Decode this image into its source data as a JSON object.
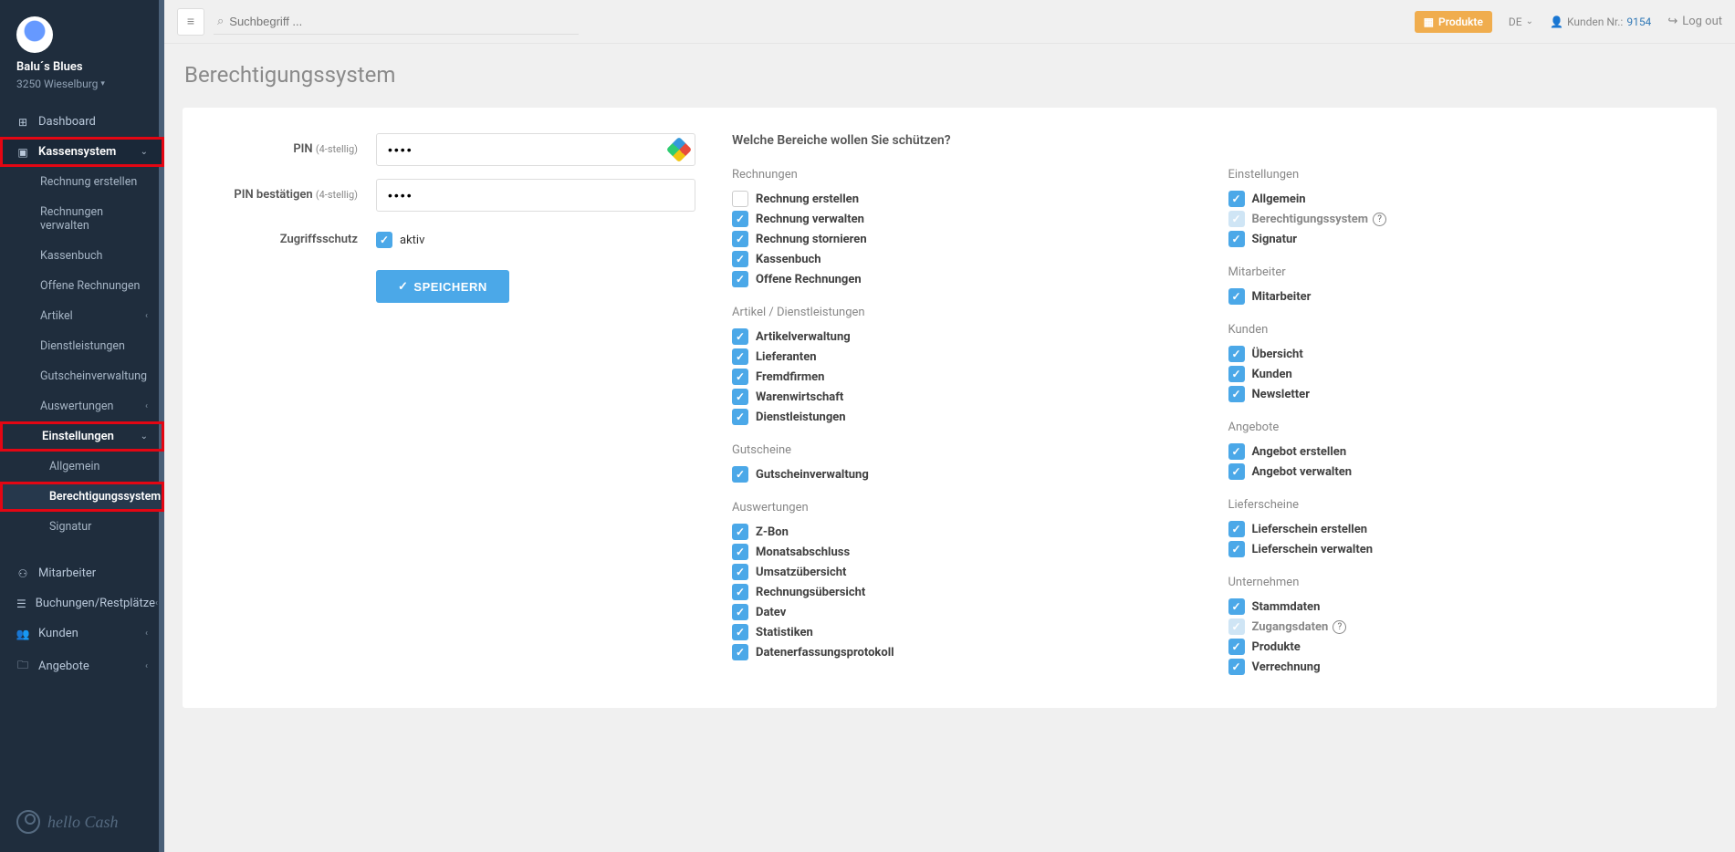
{
  "profile": {
    "name": "Balu´s Blues",
    "location": "3250 Wieselburg"
  },
  "sidebar": {
    "dashboard": "Dashboard",
    "kassensystem": "Kassensystem",
    "items": [
      "Rechnung erstellen",
      "Rechnungen verwalten",
      "Kassenbuch",
      "Offene Rechnungen",
      "Artikel",
      "Dienstleistungen",
      "Gutscheinverwaltung",
      "Auswertungen"
    ],
    "einstellungen": "Einstellungen",
    "settings_sub": [
      "Allgemein",
      "Berechtigungssystem",
      "Signatur"
    ],
    "mitarbeiter": "Mitarbeiter",
    "buchungen": "Buchungen/Restplätze",
    "kunden": "Kunden",
    "angebote": "Angebote"
  },
  "topbar": {
    "search_placeholder": "Suchbegriff ...",
    "produkte": "Produkte",
    "lang": "DE",
    "cust_label": "Kunden Nr.:",
    "cust_num": "9154",
    "logout": "Log out"
  },
  "page": {
    "title": "Berechtigungssystem"
  },
  "form": {
    "pin_label": "PIN",
    "pin_hint": "(4-stellig)",
    "pin_confirm_label": "PIN bestätigen",
    "access_label": "Zugriffsschutz",
    "aktiv": "aktiv",
    "save": "SPEICHERN"
  },
  "protect": {
    "title": "Welche Bereiche wollen Sie schützen?",
    "groups_left": [
      {
        "title": "Rechnungen",
        "items": [
          {
            "label": "Rechnung erstellen",
            "checked": false
          },
          {
            "label": "Rechnung verwalten",
            "checked": true
          },
          {
            "label": "Rechnung stornieren",
            "checked": true
          },
          {
            "label": "Kassenbuch",
            "checked": true
          },
          {
            "label": "Offene Rechnungen",
            "checked": true
          }
        ]
      },
      {
        "title": "Artikel / Dienstleistungen",
        "items": [
          {
            "label": "Artikelverwaltung",
            "checked": true
          },
          {
            "label": "Lieferanten",
            "checked": true
          },
          {
            "label": "Fremdfirmen",
            "checked": true
          },
          {
            "label": "Warenwirtschaft",
            "checked": true
          },
          {
            "label": "Dienstleistungen",
            "checked": true
          }
        ]
      },
      {
        "title": "Gutscheine",
        "items": [
          {
            "label": "Gutscheinverwaltung",
            "checked": true
          }
        ]
      },
      {
        "title": "Auswertungen",
        "items": [
          {
            "label": "Z-Bon",
            "checked": true
          },
          {
            "label": "Monatsabschluss",
            "checked": true
          },
          {
            "label": "Umsatzübersicht",
            "checked": true
          },
          {
            "label": "Rechnungsübersicht",
            "checked": true
          },
          {
            "label": "Datev",
            "checked": true
          },
          {
            "label": "Statistiken",
            "checked": true
          },
          {
            "label": "Datenerfassungsprotokoll",
            "checked": true
          }
        ]
      }
    ],
    "groups_right": [
      {
        "title": "Einstellungen",
        "items": [
          {
            "label": "Allgemein",
            "checked": true
          },
          {
            "label": "Berechtigungssystem",
            "checked": true,
            "disabled": true,
            "help": true
          },
          {
            "label": "Signatur",
            "checked": true
          }
        ]
      },
      {
        "title": "Mitarbeiter",
        "items": [
          {
            "label": "Mitarbeiter",
            "checked": true
          }
        ]
      },
      {
        "title": "Kunden",
        "items": [
          {
            "label": "Übersicht",
            "checked": true
          },
          {
            "label": "Kunden",
            "checked": true
          },
          {
            "label": "Newsletter",
            "checked": true
          }
        ]
      },
      {
        "title": "Angebote",
        "items": [
          {
            "label": "Angebot erstellen",
            "checked": true
          },
          {
            "label": "Angebot verwalten",
            "checked": true
          }
        ]
      },
      {
        "title": "Lieferscheine",
        "items": [
          {
            "label": "Lieferschein erstellen",
            "checked": true
          },
          {
            "label": "Lieferschein verwalten",
            "checked": true
          }
        ]
      },
      {
        "title": "Unternehmen",
        "items": [
          {
            "label": "Stammdaten",
            "checked": true
          },
          {
            "label": "Zugangsdaten",
            "checked": true,
            "disabled": true,
            "help": true
          },
          {
            "label": "Produkte",
            "checked": true
          },
          {
            "label": "Verrechnung",
            "checked": true
          }
        ]
      }
    ]
  },
  "logo": {
    "text": "hello Cash"
  }
}
